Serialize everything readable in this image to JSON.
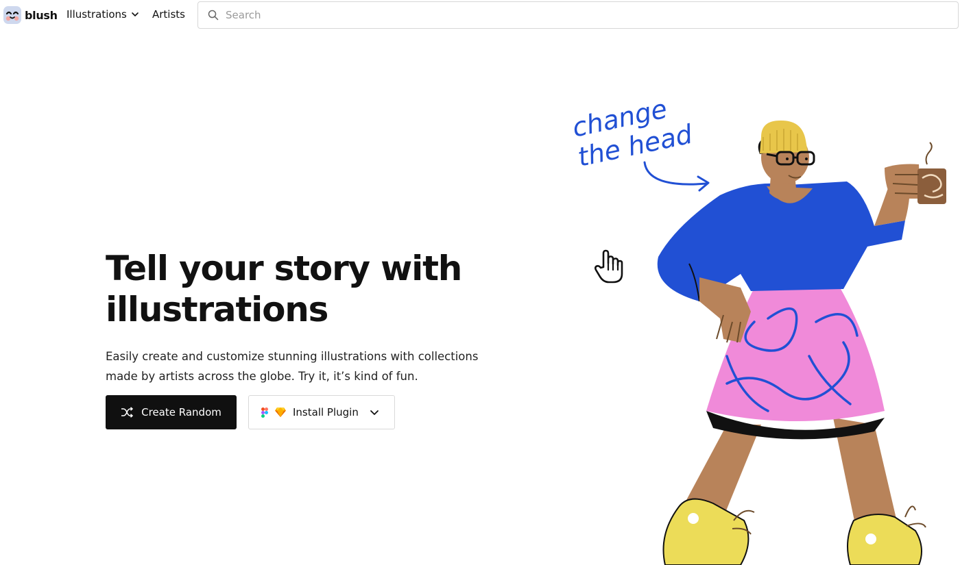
{
  "header": {
    "logo_text": "blush",
    "nav": [
      {
        "label": "Illustrations",
        "has_dropdown": true
      },
      {
        "label": "Artists"
      }
    ],
    "search": {
      "placeholder": "Search",
      "value": ""
    }
  },
  "hero": {
    "title": "Tell your story with illustrations",
    "subtitle": "Easily create and customize stunning illustrations with collections made by artists across the globe. Try it, it’s kind of fun.",
    "buttons": {
      "primary_label": "Create Random",
      "secondary_label": "Install Plugin"
    }
  },
  "illustration": {
    "annotation_line1": "change",
    "annotation_line2": "the head",
    "colors": {
      "shirt": "#2150d4",
      "skirt": "#f08ad9",
      "skin": "#b8835a",
      "hat": "#e8c64a",
      "shoes": "#ecdc58",
      "annotation": "#2150d4"
    }
  },
  "icons": {
    "logo": "blush-logo-icon",
    "search": "search-icon",
    "shuffle": "shuffle-icon",
    "figma": "figma-icon",
    "sketch": "sketch-icon",
    "cursor": "hand-cursor-icon"
  }
}
